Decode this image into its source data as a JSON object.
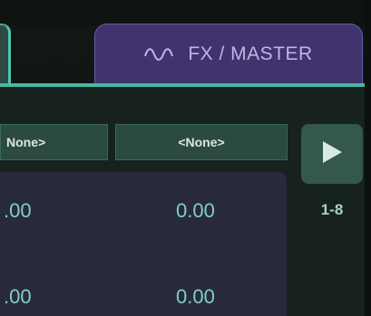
{
  "tabs": {
    "fx_master_label": "FX / MASTER",
    "fx_icon": "waveform-icon"
  },
  "header": {
    "col1_label": "None>",
    "col2_label": "<None>"
  },
  "play": {
    "icon": "play-icon",
    "range_label": "1-8"
  },
  "values": {
    "row1": [
      ".00",
      "0.00"
    ],
    "row2": [
      ".00",
      "0.00"
    ]
  },
  "colors": {
    "accent": "#4bb7a5",
    "tab_active": "#41336e",
    "value_text": "#7fd0bd"
  }
}
